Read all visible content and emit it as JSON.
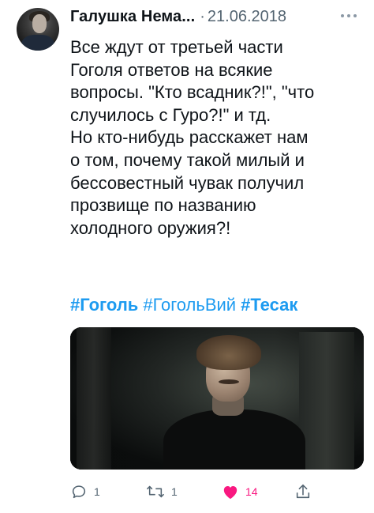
{
  "tweet": {
    "author_name": "Галушка Нема...",
    "separator": "·",
    "date": "21.06.2018",
    "text_lines": [
      "Все ждут от третьей части",
      "Гоголя ответов на всякие",
      "вопросы. \"Кто всадник?!\", \"что",
      "случилось с Гуро?!\" и тд.",
      "Но кто-нибудь расскажет нам",
      "о том, почему такой милый и",
      "бессовестный чувак получил",
      "прозвище по названию",
      "холодного оружия?!"
    ],
    "hashtags": [
      "#Гоголь",
      "#ГогольВий",
      "#Тесак"
    ],
    "media": {
      "icon": "video-still"
    }
  },
  "actions": {
    "reply": {
      "icon": "reply-icon",
      "count": "1"
    },
    "retweet": {
      "icon": "retweet-icon",
      "count": "1"
    },
    "like": {
      "icon": "heart-filled-icon",
      "count": "14",
      "color": "#f91880"
    },
    "share": {
      "icon": "share-icon"
    }
  },
  "colors": {
    "link": "#1d9bf0",
    "secondary_text": "#536471",
    "like": "#f91880"
  }
}
